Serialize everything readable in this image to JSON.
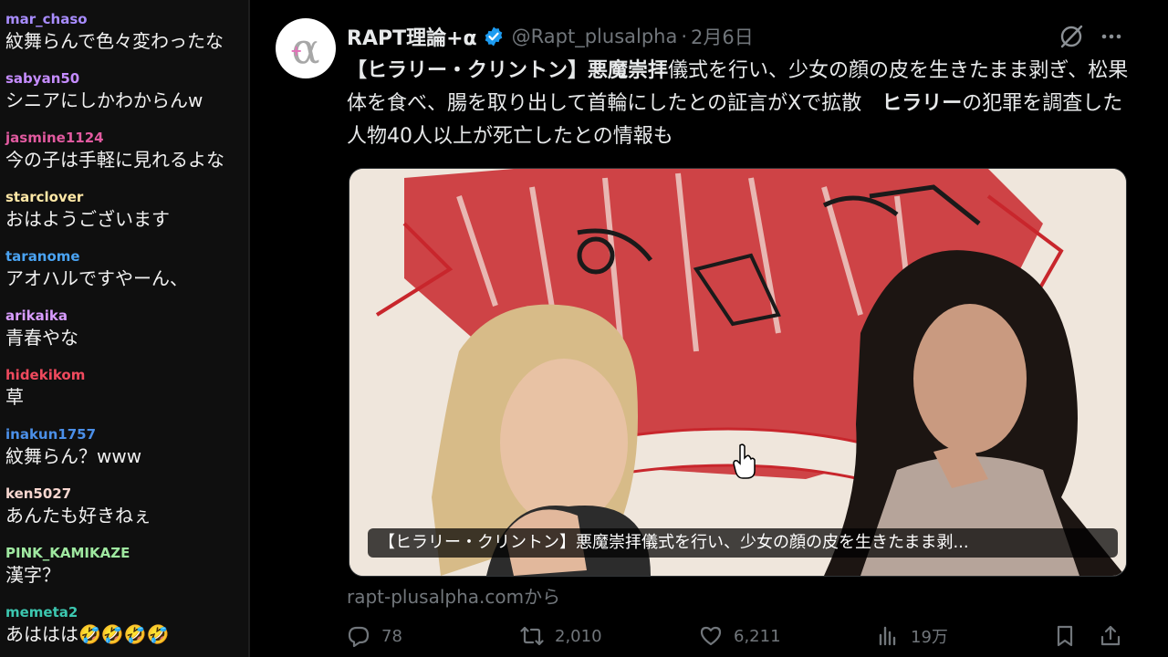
{
  "chat": [
    {
      "user": "mar_chaso",
      "color": "#a88cff",
      "text": "紋舞らんで色々変わったな"
    },
    {
      "user": "sabyan50",
      "color": "#c58cff",
      "text": "シニアにしかわからんw"
    },
    {
      "user": "jasmine1124",
      "color": "#e25aa0",
      "text": "今の子は手軽に見れるよな"
    },
    {
      "user": "starclover",
      "color": "#ffe8a6",
      "text": "おはようございます"
    },
    {
      "user": "taranome",
      "color": "#4aa3f2",
      "text": "アオハルですやーん、"
    },
    {
      "user": "arikaika",
      "color": "#d89cff",
      "text": "青春やな"
    },
    {
      "user": "hidekikom",
      "color": "#f04a5e",
      "text": "草"
    },
    {
      "user": "inakun1757",
      "color": "#4b8fe8",
      "text": "紋舞らん？www"
    },
    {
      "user": "ken5027",
      "color": "#f8d7d0",
      "text": "あんたも好きねぇ"
    },
    {
      "user": "PINK_KAMIKAZE",
      "color": "#9fe8a0",
      "text": "漢字？"
    },
    {
      "user": "memeta2",
      "color": "#3cc7b0",
      "text": "あははは🤣🤣🤣🤣"
    }
  ],
  "tweet": {
    "name": "RAPT理論+α",
    "handle": "@Rapt_plusalpha",
    "separator": "·",
    "date": "2月6日",
    "text_bold_1": "【ヒラリー・クリントン】悪魔崇拝",
    "text_1": "儀式を行い、少女の顔の皮を生きたまま剥ぎ、松果体を食べ、腸を取り出して首輪にしたとの証言がXで拡散　",
    "text_bold_2": "ヒラリー",
    "text_2": "の犯罪を調査した人物40人以上が死亡したとの情報も",
    "media_caption": "【ヒラリー・クリントン】悪魔崇拝儀式を行い、少女の顔の皮を生きたまま剥...",
    "source": "rapt-plusalpha.comから",
    "stats": {
      "replies": "78",
      "retweets": "2,010",
      "likes": "6,211",
      "views": "19万"
    }
  },
  "colors": {
    "verified": "#1d9bf0",
    "muted": "#71767b",
    "text": "#e7e9ea"
  },
  "icons": [
    "verified-badge-icon",
    "grok-icon",
    "more-icon",
    "reply-icon",
    "retweet-icon",
    "like-icon",
    "views-icon",
    "bookmark-icon",
    "share-icon",
    "hand-cursor-icon"
  ]
}
